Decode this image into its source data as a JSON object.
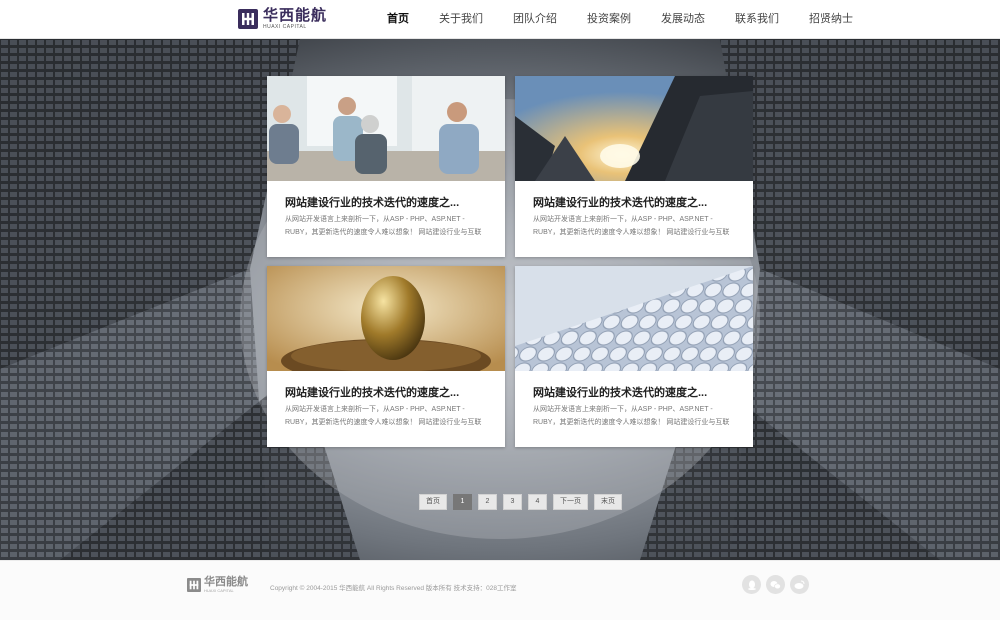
{
  "brand": {
    "name_cn": "华西能航",
    "name_en": "HUAXI CAPITAL"
  },
  "nav": {
    "items": [
      {
        "label": "首页",
        "active": true
      },
      {
        "label": "关于我们"
      },
      {
        "label": "团队介绍"
      },
      {
        "label": "投资案例"
      },
      {
        "label": "发展动态"
      },
      {
        "label": "联系我们"
      },
      {
        "label": "招贤纳士"
      }
    ]
  },
  "cards": [
    {
      "title": "网站建设行业的技术迭代的速度之...",
      "desc": "从网站开发语言上来剖析一下，从ASP - PHP、ASP.NET - RUBY，其更新迭代的速度令人难以想象！ 网站建设行业与互联",
      "image": "meeting-photo"
    },
    {
      "title": "网站建设行业的技术迭代的速度之...",
      "desc": "从网站开发语言上来剖析一下，从ASP - PHP、ASP.NET - RUBY，其更新迭代的速度令人难以想象！ 网站建设行业与互联",
      "image": "skyscraper-sunlight-photo"
    },
    {
      "title": "网站建设行业的技术迭代的速度之...",
      "desc": "从网站开发语言上来剖析一下，从ASP - PHP、ASP.NET - RUBY，其更新迭代的速度令人难以想象！ 网站建设行业与互联",
      "image": "golden-egg-nest-photo"
    },
    {
      "title": "网站建设行业的技术迭代的速度之...",
      "desc": "从网站开发语言上来剖析一下，从ASP - PHP、ASP.NET - RUBY，其更新迭代的速度令人难以想象！ 网站建设行业与互联",
      "image": "water-cube-facade-photo"
    }
  ],
  "pager": {
    "first": "首页",
    "pages": [
      "1",
      "2",
      "3",
      "4"
    ],
    "current": "1",
    "next": "下一页",
    "last": "末页"
  },
  "footer": {
    "copyright": "Copyright © 2004-2015 华西能航 All Rights Reserved 版本所有    技术支持：028工作室",
    "socials": [
      "qq-icon",
      "wechat-icon",
      "weibo-icon"
    ]
  },
  "colors": {
    "brand": "#3a2d5c",
    "header_bg": "#ffffff",
    "footer_bg": "#fbfbfb",
    "pager_active": "#777777"
  }
}
